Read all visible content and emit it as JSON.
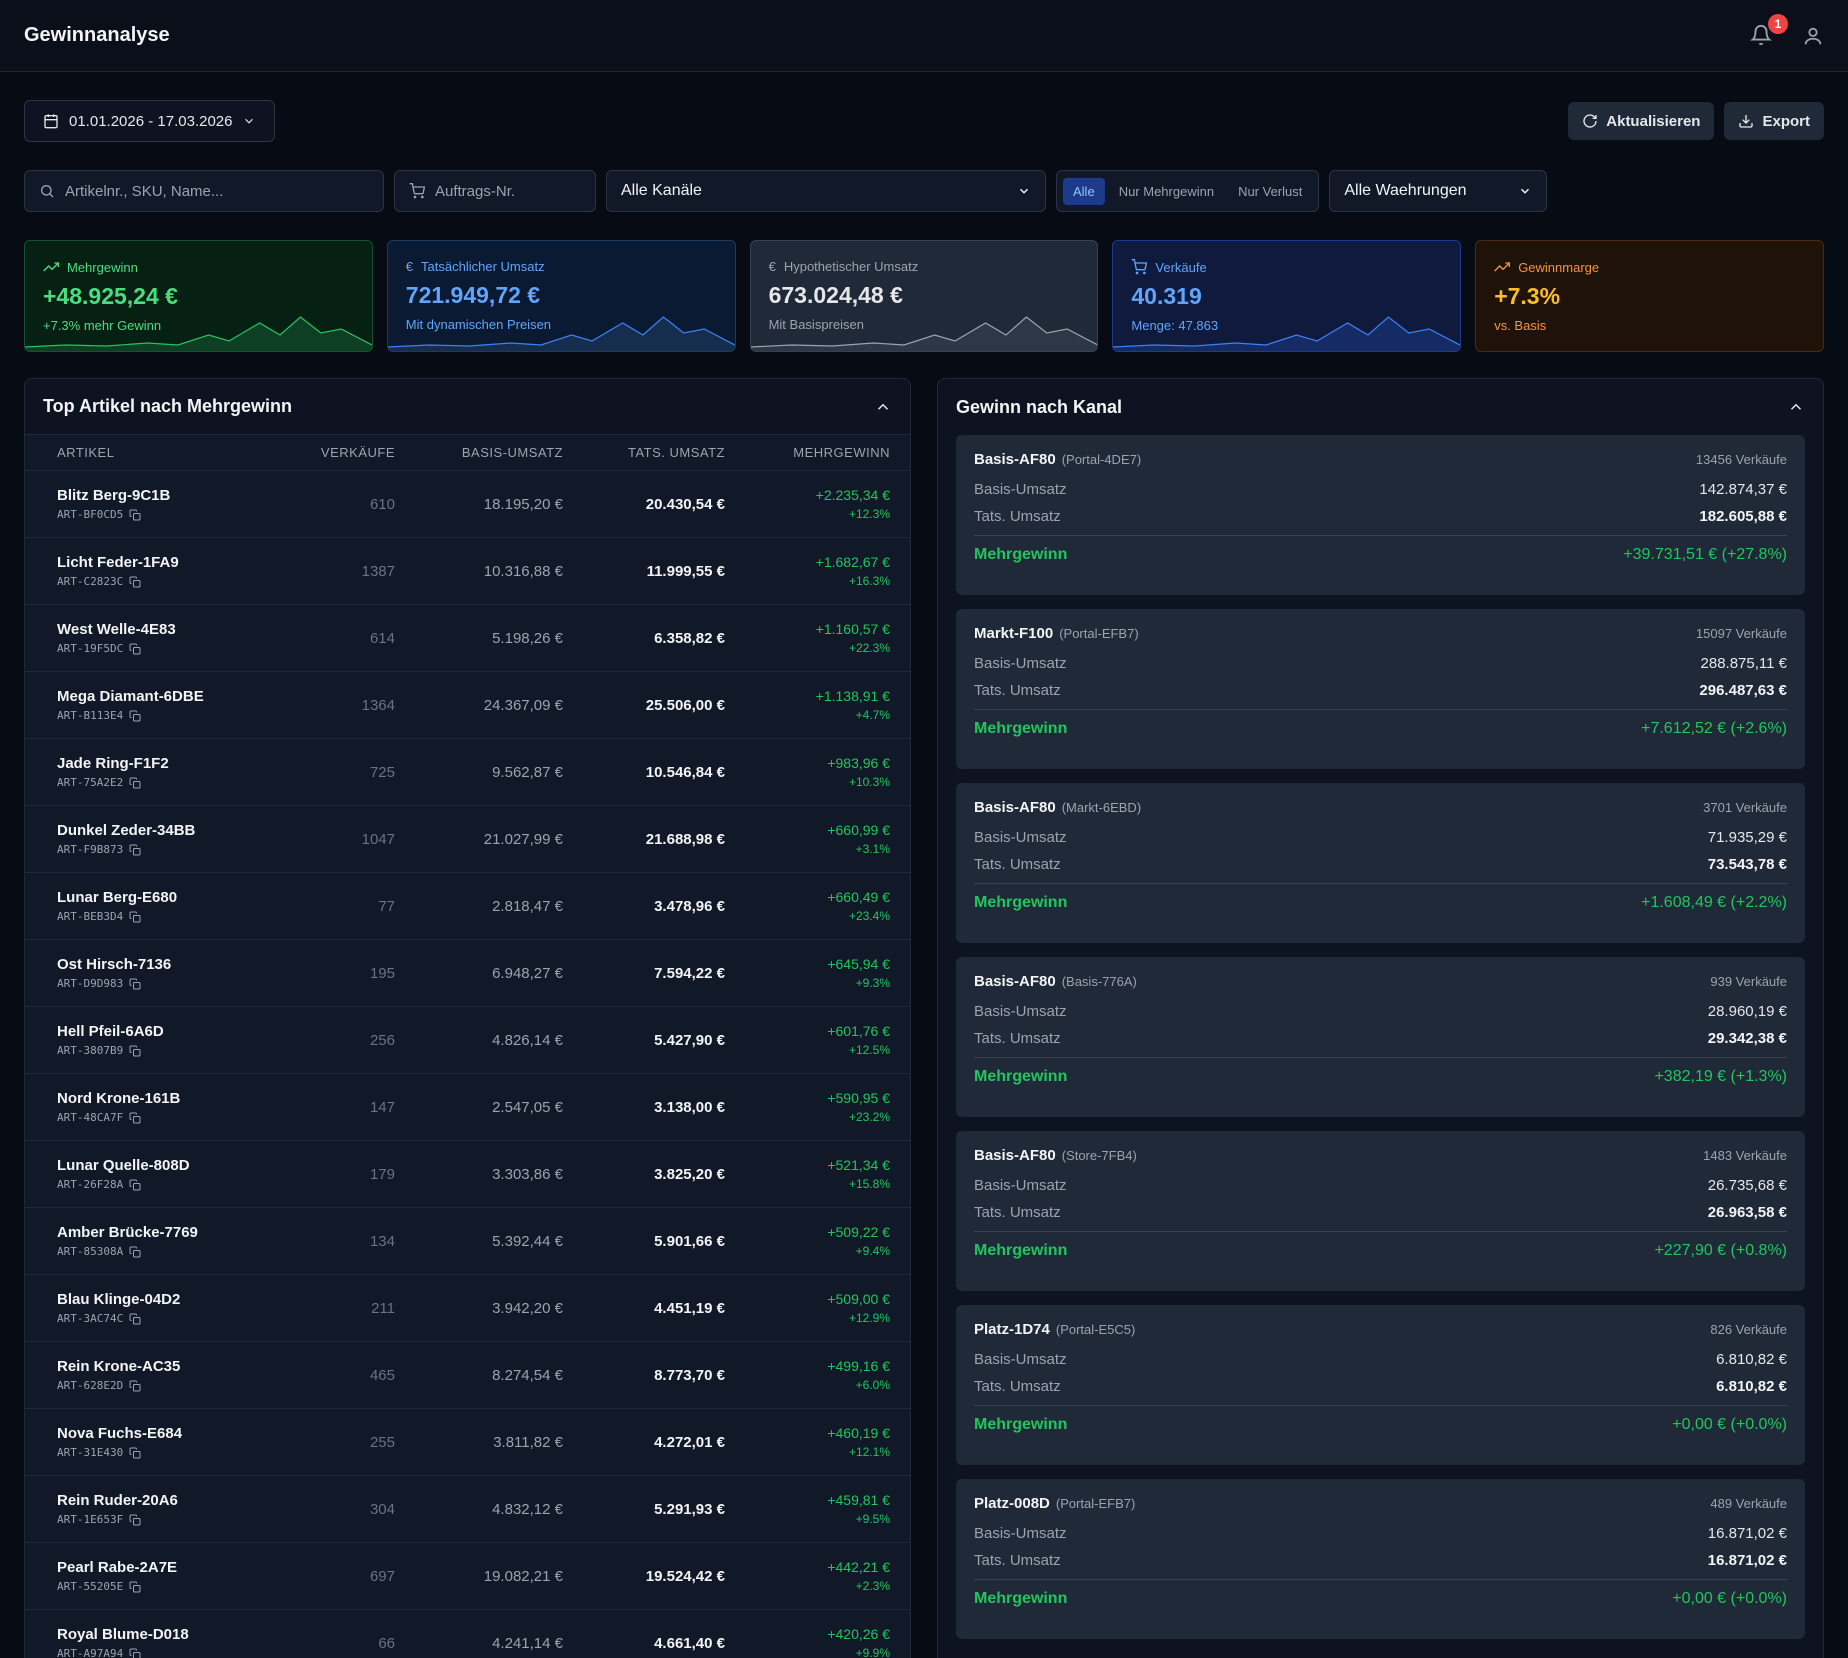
{
  "app": {
    "title": "Gewinnanalyse",
    "notifications": "1"
  },
  "toolbar": {
    "date_range": "01.01.2026 - 17.03.2026",
    "refresh": "Aktualisieren",
    "export": "Export"
  },
  "filters": {
    "search_placeholder": "Artikelnr., SKU, Name...",
    "order_placeholder": "Auftrags-Nr.",
    "channel_select": "Alle Kanäle",
    "segment": [
      "Alle",
      "Nur Mehrgewinn",
      "Nur Verlust"
    ],
    "currency_select": "Alle Waehrungen"
  },
  "kpis": [
    {
      "label": "Mehrgewinn",
      "value": "+48.925,24 €",
      "sub": "+7.3% mehr Gewinn",
      "icon": "trend-up-icon",
      "color": "#4ade80"
    },
    {
      "label": "Tatsächlicher Umsatz",
      "value": "721.949,72 €",
      "sub": "Mit dynamischen Preisen",
      "icon": "euro-icon",
      "color": "#60a5fa"
    },
    {
      "label": "Hypothetischer Umsatz",
      "value": "673.024,48 €",
      "sub": "Mit Basispreisen",
      "icon": "euro-icon",
      "color": "#9ca3af"
    },
    {
      "label": "Verkäufe",
      "value": "40.319",
      "sub": "Menge: 47.863",
      "icon": "cart-icon",
      "color": "#60a5fa"
    },
    {
      "label": "Gewinnmarge",
      "value": "+7.3%",
      "sub": "vs. Basis",
      "icon": "trend-up-icon",
      "color": "#fb923c"
    }
  ],
  "top_articles": {
    "title": "Top Artikel nach Mehrgewinn",
    "columns": [
      "ARTIKEL",
      "VERKÄUFE",
      "BASIS-UMSATZ",
      "TATS. UMSATZ",
      "MEHRGEWINN"
    ],
    "rows": [
      {
        "name": "Blitz Berg-9C1B",
        "code": "ART-BF0CD5",
        "sales": "610",
        "basis": "18.195,20 €",
        "tats": "20.430,54 €",
        "gain": "+2.235,34 €",
        "pct": "+12.3%"
      },
      {
        "name": "Licht Feder-1FA9",
        "code": "ART-C2823C",
        "sales": "1387",
        "basis": "10.316,88 €",
        "tats": "11.999,55 €",
        "gain": "+1.682,67 €",
        "pct": "+16.3%"
      },
      {
        "name": "West Welle-4E83",
        "code": "ART-19F5DC",
        "sales": "614",
        "basis": "5.198,26 €",
        "tats": "6.358,82 €",
        "gain": "+1.160,57 €",
        "pct": "+22.3%"
      },
      {
        "name": "Mega Diamant-6DBE",
        "code": "ART-B113E4",
        "sales": "1364",
        "basis": "24.367,09 €",
        "tats": "25.506,00 €",
        "gain": "+1.138,91 €",
        "pct": "+4.7%"
      },
      {
        "name": "Jade Ring-F1F2",
        "code": "ART-75A2E2",
        "sales": "725",
        "basis": "9.562,87 €",
        "tats": "10.546,84 €",
        "gain": "+983,96 €",
        "pct": "+10.3%"
      },
      {
        "name": "Dunkel Zeder-34BB",
        "code": "ART-F9B873",
        "sales": "1047",
        "basis": "21.027,99 €",
        "tats": "21.688,98 €",
        "gain": "+660,99 €",
        "pct": "+3.1%"
      },
      {
        "name": "Lunar Berg-E680",
        "code": "ART-BEB3D4",
        "sales": "77",
        "basis": "2.818,47 €",
        "tats": "3.478,96 €",
        "gain": "+660,49 €",
        "pct": "+23.4%"
      },
      {
        "name": "Ost Hirsch-7136",
        "code": "ART-D9D983",
        "sales": "195",
        "basis": "6.948,27 €",
        "tats": "7.594,22 €",
        "gain": "+645,94 €",
        "pct": "+9.3%"
      },
      {
        "name": "Hell Pfeil-6A6D",
        "code": "ART-3807B9",
        "sales": "256",
        "basis": "4.826,14 €",
        "tats": "5.427,90 €",
        "gain": "+601,76 €",
        "pct": "+12.5%"
      },
      {
        "name": "Nord Krone-161B",
        "code": "ART-48CA7F",
        "sales": "147",
        "basis": "2.547,05 €",
        "tats": "3.138,00 €",
        "gain": "+590,95 €",
        "pct": "+23.2%"
      },
      {
        "name": "Lunar Quelle-808D",
        "code": "ART-26F28A",
        "sales": "179",
        "basis": "3.303,86 €",
        "tats": "3.825,20 €",
        "gain": "+521,34 €",
        "pct": "+15.8%"
      },
      {
        "name": "Amber Brücke-7769",
        "code": "ART-85308A",
        "sales": "134",
        "basis": "5.392,44 €",
        "tats": "5.901,66 €",
        "gain": "+509,22 €",
        "pct": "+9.4%"
      },
      {
        "name": "Blau Klinge-04D2",
        "code": "ART-3AC74C",
        "sales": "211",
        "basis": "3.942,20 €",
        "tats": "4.451,19 €",
        "gain": "+509,00 €",
        "pct": "+12.9%"
      },
      {
        "name": "Rein Krone-AC35",
        "code": "ART-628E2D",
        "sales": "465",
        "basis": "8.274,54 €",
        "tats": "8.773,70 €",
        "gain": "+499,16 €",
        "pct": "+6.0%"
      },
      {
        "name": "Nova Fuchs-E684",
        "code": "ART-31E430",
        "sales": "255",
        "basis": "3.811,82 €",
        "tats": "4.272,01 €",
        "gain": "+460,19 €",
        "pct": "+12.1%"
      },
      {
        "name": "Rein Ruder-20A6",
        "code": "ART-1E653F",
        "sales": "304",
        "basis": "4.832,12 €",
        "tats": "5.291,93 €",
        "gain": "+459,81 €",
        "pct": "+9.5%"
      },
      {
        "name": "Pearl Rabe-2A7E",
        "code": "ART-55205E",
        "sales": "697",
        "basis": "19.082,21 €",
        "tats": "19.524,42 €",
        "gain": "+442,21 €",
        "pct": "+2.3%"
      },
      {
        "name": "Royal Blume-D018",
        "code": "ART-A97A94",
        "sales": "66",
        "basis": "4.241,14 €",
        "tats": "4.661,40 €",
        "gain": "+420,26 €",
        "pct": "+9.9%"
      }
    ]
  },
  "channels": {
    "title": "Gewinn nach Kanal",
    "basis_label": "Basis-Umsatz",
    "tats_label": "Tats. Umsatz",
    "gain_label": "Mehrgewinn",
    "items": [
      {
        "name": "Basis-AF80",
        "sub": "(Portal-4DE7)",
        "sales": "13456 Verkäufe",
        "basis": "142.874,37 €",
        "tats": "182.605,88 €",
        "gain": "+39.731,51 € (+27.8%)"
      },
      {
        "name": "Markt-F100",
        "sub": "(Portal-EFB7)",
        "sales": "15097 Verkäufe",
        "basis": "288.875,11 €",
        "tats": "296.487,63 €",
        "gain": "+7.612,52 € (+2.6%)"
      },
      {
        "name": "Basis-AF80",
        "sub": "(Markt-6EBD)",
        "sales": "3701 Verkäufe",
        "basis": "71.935,29 €",
        "tats": "73.543,78 €",
        "gain": "+1.608,49 € (+2.2%)"
      },
      {
        "name": "Basis-AF80",
        "sub": "(Basis-776A)",
        "sales": "939 Verkäufe",
        "basis": "28.960,19 €",
        "tats": "29.342,38 €",
        "gain": "+382,19 € (+1.3%)"
      },
      {
        "name": "Basis-AF80",
        "sub": "(Store-7FB4)",
        "sales": "1483 Verkäufe",
        "basis": "26.735,68 €",
        "tats": "26.963,58 €",
        "gain": "+227,90 € (+0.8%)"
      },
      {
        "name": "Platz-1D74",
        "sub": "(Portal-E5C5)",
        "sales": "826 Verkäufe",
        "basis": "6.810,82 €",
        "tats": "6.810,82 €",
        "gain": "+0,00 € (+0.0%)"
      },
      {
        "name": "Platz-008D",
        "sub": "(Portal-EFB7)",
        "sales": "489 Verkäufe",
        "basis": "16.871,02 €",
        "tats": "16.871,02 €",
        "gain": "+0,00 € (+0.0%)"
      }
    ]
  }
}
